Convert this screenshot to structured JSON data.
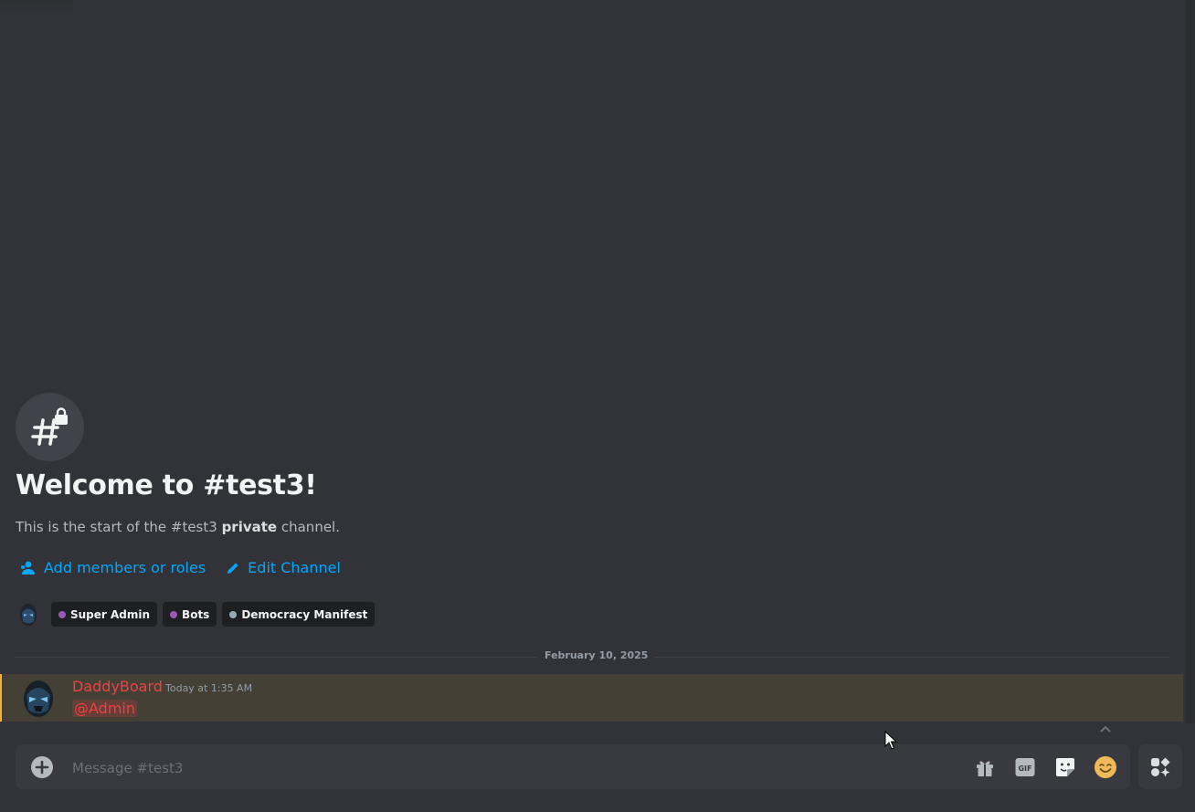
{
  "channel": {
    "welcome_title": "Welcome to #test3!",
    "subtitle_prefix": "This is the start of the #test3 ",
    "subtitle_bold": "private",
    "subtitle_suffix": " channel."
  },
  "actions": {
    "add_members_label": "Add members or roles",
    "edit_channel_label": "Edit Channel"
  },
  "roles": [
    {
      "name": "Super Admin",
      "color": "#9b59b6"
    },
    {
      "name": "Bots",
      "color": "#9b59b6"
    },
    {
      "name": "Democracy Manifest",
      "color": "#99aab5"
    }
  ],
  "date_divider": "February 10, 2025",
  "message": {
    "author": "DaddyBoard",
    "timestamp": "Today at 1:35 AM",
    "content": "@Admin"
  },
  "composer": {
    "placeholder": "Message #test3"
  },
  "icons": {
    "channel": "private-channel-hash-lock-icon",
    "add_members": "people-icon",
    "edit": "pencil-icon",
    "upload": "plus-circle-icon",
    "gift": "gift-icon",
    "gif": "gif-icon",
    "sticker": "sticker-icon",
    "emoji": "emoji-icon",
    "apps": "apps-icon",
    "jump": "chevron-up-icon"
  },
  "colors": {
    "background": "#313338",
    "link": "#00a8fc",
    "mention": "#f23f42",
    "highlight": "#444036",
    "highlight_bar": "#f0b232"
  }
}
